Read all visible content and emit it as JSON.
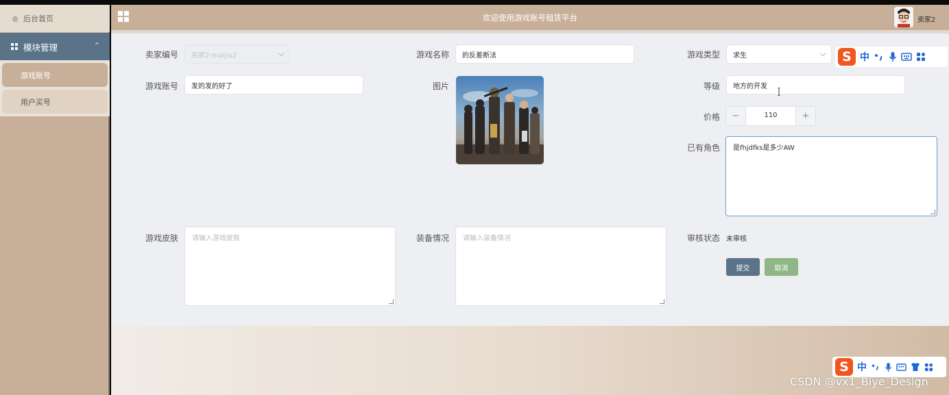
{
  "header": {
    "title": "欢迎使用游戏账号租赁平台",
    "username": "卖家2"
  },
  "sidebar": {
    "home": "后台首页",
    "module": "模块管理",
    "items": [
      {
        "label": "游戏账号",
        "active": true
      },
      {
        "label": "用户买号",
        "active": false
      }
    ]
  },
  "form": {
    "seller_no": {
      "label": "卖家编号",
      "value": "卖家2-maijia2"
    },
    "game_name": {
      "label": "游戏名称",
      "value": "的反差断法"
    },
    "game_type": {
      "label": "游戏类型",
      "value": "求生"
    },
    "account": {
      "label": "游戏账号",
      "value": "发的发的好了"
    },
    "image": {
      "label": "图片"
    },
    "level": {
      "label": "等级",
      "value": "地方的开发"
    },
    "price": {
      "label": "价格",
      "value": "110",
      "minus": "−",
      "plus": "+"
    },
    "roles": {
      "label": "已有角色",
      "value": "是fhjdfks是多少AW"
    },
    "skin": {
      "label": "游戏皮肤",
      "placeholder": "请输入游戏皮肤"
    },
    "equipment": {
      "label": "装备情况",
      "placeholder": "请输入装备情况"
    },
    "audit": {
      "label": "审核状态",
      "value": "未审核"
    },
    "submit_label": "提交",
    "cancel_label": "取消"
  },
  "ime": {
    "logo": "S",
    "mode": "中"
  },
  "watermark": "CSDN @vx1_Biye_Design",
  "colors": {
    "accent_brown": "#c8af99",
    "module_blue": "#5b7388",
    "cancel_green": "#8fb686"
  }
}
